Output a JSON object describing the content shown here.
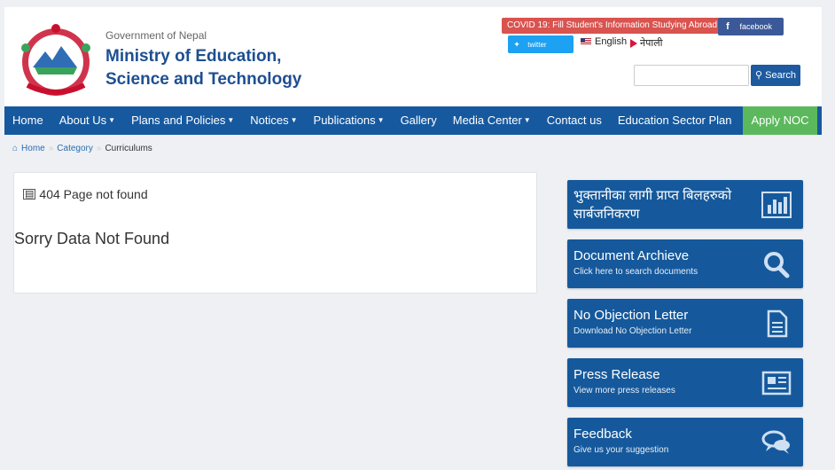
{
  "header": {
    "gov": "Government of Nepal",
    "ministry_line1": "Ministry of Education,",
    "ministry_line2": "Science and Technology",
    "covid_link": "COVID 19: Fill Student's Information Studying Abroad",
    "facebook": "facebook",
    "twitter": "twitter",
    "lang_en": "English",
    "lang_np": "नेपाली",
    "search_placeholder": "",
    "search_button": "Search"
  },
  "nav": {
    "items": [
      {
        "label": "Home",
        "dropdown": false
      },
      {
        "label": "About Us",
        "dropdown": true
      },
      {
        "label": "Plans and Policies",
        "dropdown": true
      },
      {
        "label": "Notices",
        "dropdown": true
      },
      {
        "label": "Publications",
        "dropdown": true
      },
      {
        "label": "Gallery",
        "dropdown": false
      },
      {
        "label": "Media Center",
        "dropdown": true
      },
      {
        "label": "Contact us",
        "dropdown": false
      },
      {
        "label": "Education Sector Plan",
        "dropdown": false
      }
    ],
    "apply_noc": "Apply NOC"
  },
  "breadcrumb": {
    "home": "Home",
    "category": "Category",
    "current": "Curriculums"
  },
  "content": {
    "heading": "404 Page not found",
    "message": "Sorry Data Not Found"
  },
  "sidebar": {
    "cards": [
      {
        "title": "भुक्तानीका लागी प्राप्त बिलहरुको सार्बजनिकरण",
        "subtitle": "",
        "icon": "bar-chart-icon"
      },
      {
        "title": "Document Archieve",
        "subtitle": "Click here to search documents",
        "icon": "search-icon"
      },
      {
        "title": "No Objection Letter",
        "subtitle": "Download No Objection Letter",
        "icon": "document-icon"
      },
      {
        "title": "Press Release",
        "subtitle": "View more press releases",
        "icon": "newspaper-icon"
      },
      {
        "title": "Feedback",
        "subtitle": "Give us your suggestion",
        "icon": "chat-icon"
      }
    ]
  },
  "colors": {
    "brand_blue": "#16599f",
    "apply_green": "#5cb85c",
    "covid_red": "#d9534f"
  }
}
